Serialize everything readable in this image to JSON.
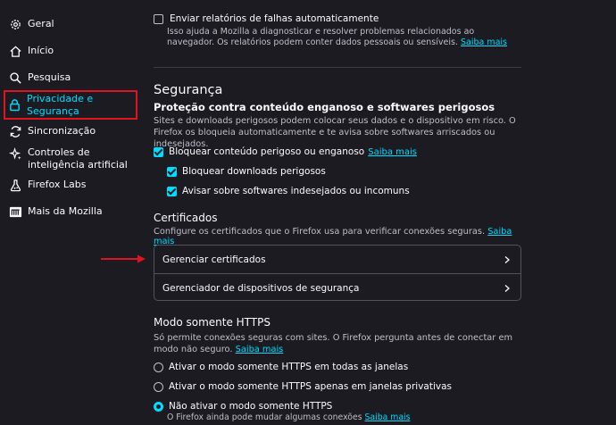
{
  "sidebar": {
    "items": [
      {
        "label": "Geral",
        "icon": "gear-icon"
      },
      {
        "label": "Início",
        "icon": "home-icon"
      },
      {
        "label": "Pesquisa",
        "icon": "search-icon"
      },
      {
        "label": "Privacidade e Segurança",
        "icon": "lock-icon",
        "selected": true
      },
      {
        "label": "Sincronização",
        "icon": "sync-icon"
      },
      {
        "label": "Controles de inteligência artificial",
        "icon": "sparkle-icon"
      },
      {
        "label": "Firefox Labs",
        "icon": "flask-icon"
      },
      {
        "label": "Mais da Mozilla",
        "icon": "mozilla-icon"
      }
    ]
  },
  "crash": {
    "label": "Enviar relatórios de falhas automaticamente",
    "description": "Isso ajuda a Mozilla a diagnosticar e resolver problemas relacionados ao navegador. Os relatórios podem conter dados pessoais ou sensíveis.",
    "link": "Saiba mais"
  },
  "security": {
    "title": "Segurança",
    "subtitle": "Proteção contra conteúdo enganoso e softwares perigosos",
    "description": "Sites e downloads perigosos podem colocar seus dados e o dispositivo em risco. O Firefox os bloqueia automaticamente e te avisa sobre softwares arriscados ou indesejados.",
    "block_deceptive": "Bloquear conteúdo perigoso ou enganoso",
    "block_deceptive_link": "Saiba mais",
    "block_downloads": "Bloquear downloads perigosos",
    "warn_unwanted": "Avisar sobre softwares indesejados ou incomuns"
  },
  "certificates": {
    "title": "Certificados",
    "description": "Configure os certificados que o Firefox usa para verificar conexões seguras.",
    "link": "Saiba mais",
    "manage": "Gerenciar certificados",
    "devices": "Gerenciador de dispositivos de segurança"
  },
  "https": {
    "title": "Modo somente HTTPS",
    "description": "Só permite conexões seguras com sites. O Firefox pergunta antes de conectar em modo não seguro.",
    "link": "Saiba mais",
    "options": [
      {
        "label": "Ativar o modo somente HTTPS em todas as janelas"
      },
      {
        "label": "Ativar o modo somente HTTPS apenas em janelas privativas"
      },
      {
        "label": "Não ativar o modo somente HTTPS",
        "note": "O Firefox ainda pode mudar algumas conexões",
        "note_link": "Saiba mais",
        "selected": true
      }
    ]
  },
  "colors": {
    "accent": "#00ddff",
    "background": "#1c1b22",
    "highlight": "#e0141e"
  }
}
